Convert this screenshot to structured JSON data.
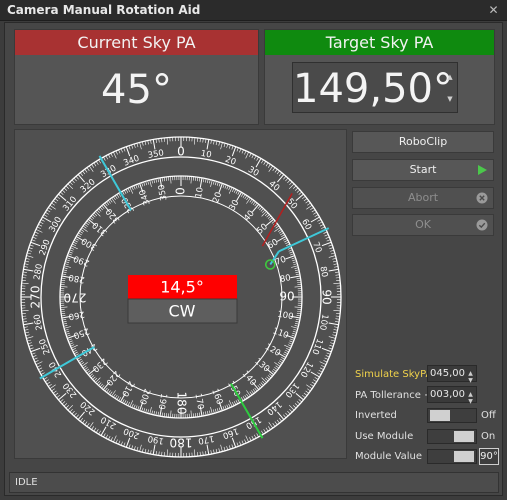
{
  "window": {
    "title": "Camera Manual Rotation Aid",
    "close_glyph": "✕"
  },
  "current": {
    "label": "Current Sky PA",
    "value": "45°"
  },
  "target": {
    "label": "Target Sky PA",
    "value": "149,50°"
  },
  "dial": {
    "current_angle": 45,
    "target_angle": 149.5,
    "readout": "14,5°",
    "direction": "CW",
    "marker_angles": [
      65,
      330,
      240,
      150
    ]
  },
  "buttons": {
    "roboclip": "RoboClip",
    "start": "Start",
    "abort": "Abort",
    "ok": "OK"
  },
  "settings": {
    "simulate_label": "Simulate SkyPA",
    "simulate_value": "045,00",
    "tolerance_label": "PA Tollerance +/-",
    "tolerance_value": "003,00",
    "inverted_label": "Inverted",
    "inverted_state": "Off",
    "use_module_label": "Use Module",
    "use_module_state": "On",
    "module_value_label": "Module Value",
    "module_value": "90°"
  },
  "status": "IDLE",
  "colors": {
    "red": "#a83232",
    "green": "#0f8a0f",
    "cyan": "#3ec8d8",
    "readout_red": "#ff0000"
  },
  "icons": {
    "start": "play-icon",
    "abort": "close-circle-icon",
    "ok": "check-circle-icon"
  }
}
